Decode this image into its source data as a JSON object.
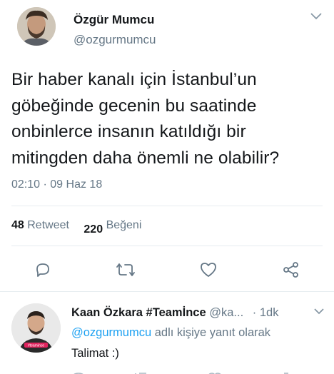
{
  "main_tweet": {
    "author_name": "Özgür Mumcu",
    "author_handle": "@ozgurmumcu",
    "text": "Bir haber kanalı için İstanbul’un göbeğinde gecenin bu saatinde onbinlerce insanın katıldığı bir mitingden daha önemli ne olabilir?",
    "time": "02:10",
    "separator": "·",
    "date": "09 Haz 18",
    "retweet_count": "48",
    "retweet_label": "Retweet",
    "like_count": "220",
    "like_label": "Beğeni",
    "icons": [
      "reply-icon",
      "retweet-icon",
      "like-icon",
      "share-icon"
    ]
  },
  "reply_tweet": {
    "author_name": "Kaan Özkara #Teamİnce",
    "author_handle": "@ka...",
    "separator": "·",
    "time": "1dk",
    "reply_prefix_link": "@ozgurmumcu",
    "reply_prefix_text": "adlı kişiye yanıt olarak",
    "text": "Talimat :)",
    "avatar_badge": "#teamince"
  },
  "colors": {
    "text": "#14171a",
    "secondary": "#657786",
    "link": "#1da1f2",
    "divider": "#e6ecf0",
    "badge": "#e0245e"
  }
}
